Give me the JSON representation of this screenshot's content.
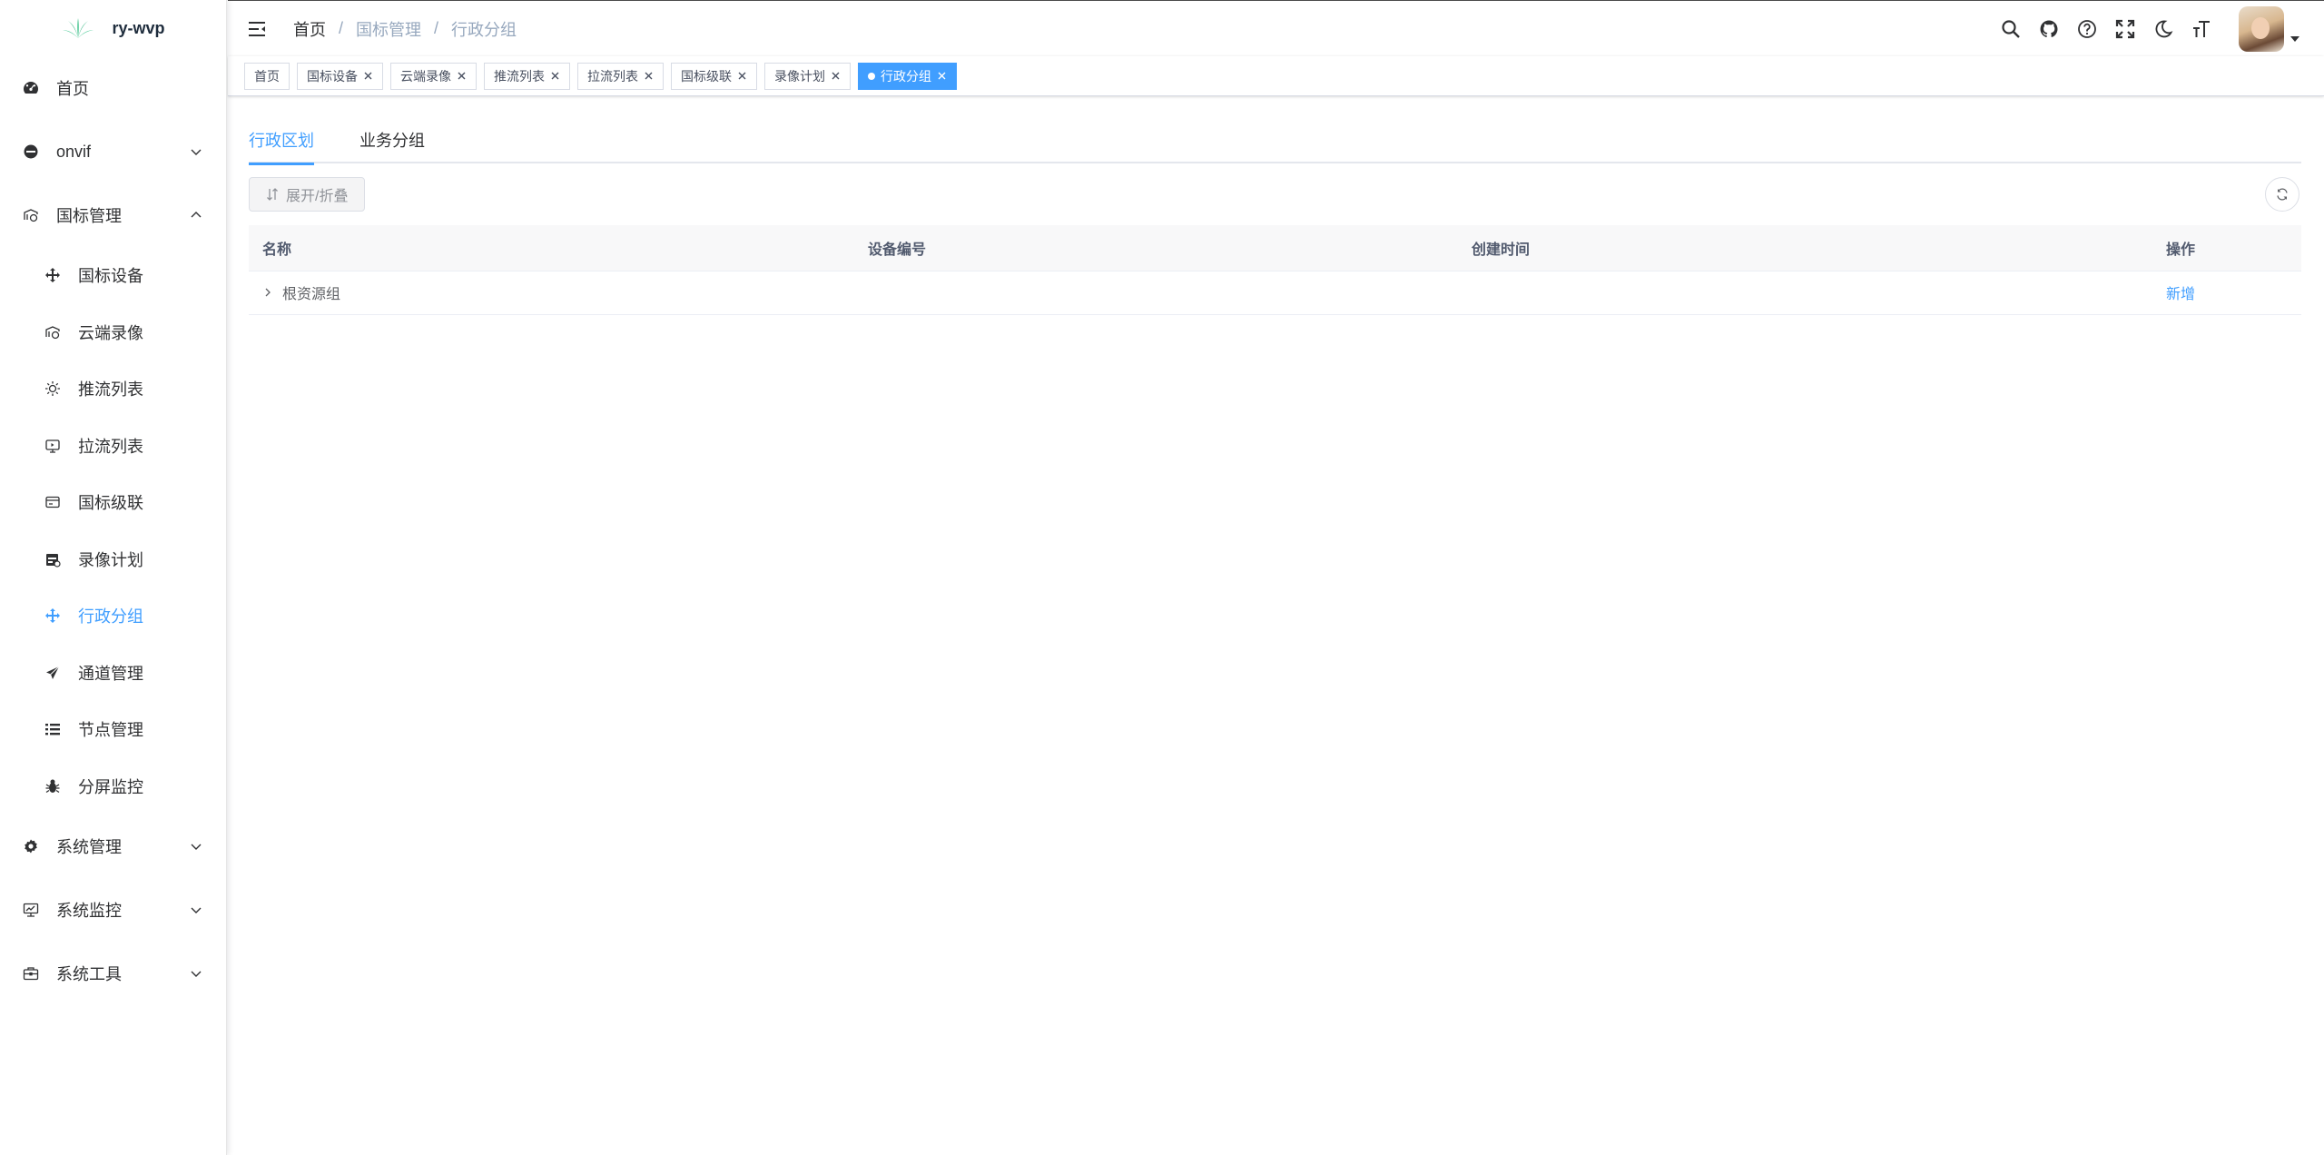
{
  "app": {
    "logo_text": "ry-wvp"
  },
  "sidebar": {
    "items": [
      {
        "label": "首页",
        "icon": "dashboard-icon"
      },
      {
        "label": "onvif",
        "icon": "minus-circle-icon"
      },
      {
        "label": "国标管理",
        "icon": "education-icon"
      },
      {
        "label": "系统管理",
        "icon": "gear-icon"
      },
      {
        "label": "系统监控",
        "icon": "monitor-icon"
      },
      {
        "label": "系统工具",
        "icon": "toolbox-icon"
      }
    ],
    "submenu": [
      {
        "label": "国标设备",
        "icon": "move-icon"
      },
      {
        "label": "云端录像",
        "icon": "education-icon"
      },
      {
        "label": "推流列表",
        "icon": "sun-icon"
      },
      {
        "label": "拉流列表",
        "icon": "screen-icon"
      },
      {
        "label": "国标级联",
        "icon": "card-icon"
      },
      {
        "label": "录像计划",
        "icon": "calendar-icon"
      },
      {
        "label": "行政分组",
        "icon": "move-icon"
      },
      {
        "label": "通道管理",
        "icon": "send-icon"
      },
      {
        "label": "节点管理",
        "icon": "list-icon"
      },
      {
        "label": "分屏监控",
        "icon": "bug-icon"
      }
    ]
  },
  "breadcrumb": [
    "首页",
    "国标管理",
    "行政分组"
  ],
  "tags": [
    "首页",
    "国标设备",
    "云端录像",
    "推流列表",
    "拉流列表",
    "国标级联",
    "录像计划",
    "行政分组"
  ],
  "tabs": [
    "行政区划",
    "业务分组"
  ],
  "toolbar": {
    "expand_label": "展开/折叠"
  },
  "table": {
    "headers": [
      "名称",
      "设备编号",
      "创建时间",
      "操作"
    ],
    "rows": [
      {
        "name": "根资源组",
        "code": "",
        "created": "",
        "action": "新增"
      }
    ]
  },
  "colors": {
    "accent": "#409eff"
  }
}
